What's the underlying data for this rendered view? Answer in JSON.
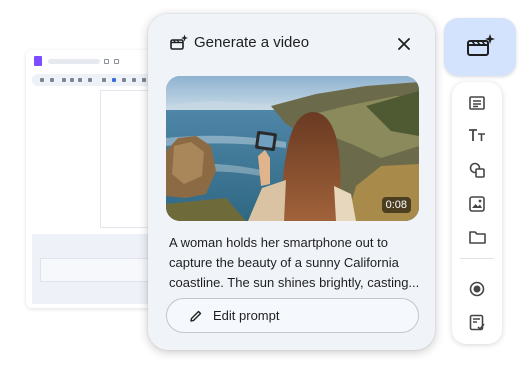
{
  "card": {
    "title": "Generate a video",
    "description": "A woman holds her smartphone out to capture the beauty of a sunny California coastline. The sun shines brightly, casting...",
    "video": {
      "duration": "0:08"
    },
    "edit_button_label": "Edit prompt"
  },
  "rail": {
    "active_button_icon": "generate-video-icon",
    "icons": [
      "text-box-icon",
      "text-size-icon",
      "shapes-icon",
      "image-icon",
      "folder-icon",
      "record-icon",
      "notes-icon"
    ]
  },
  "colors": {
    "card_background": "#f0f4f9",
    "rail_active": "#d3e3fd",
    "text_primary": "#1f1f1f"
  }
}
